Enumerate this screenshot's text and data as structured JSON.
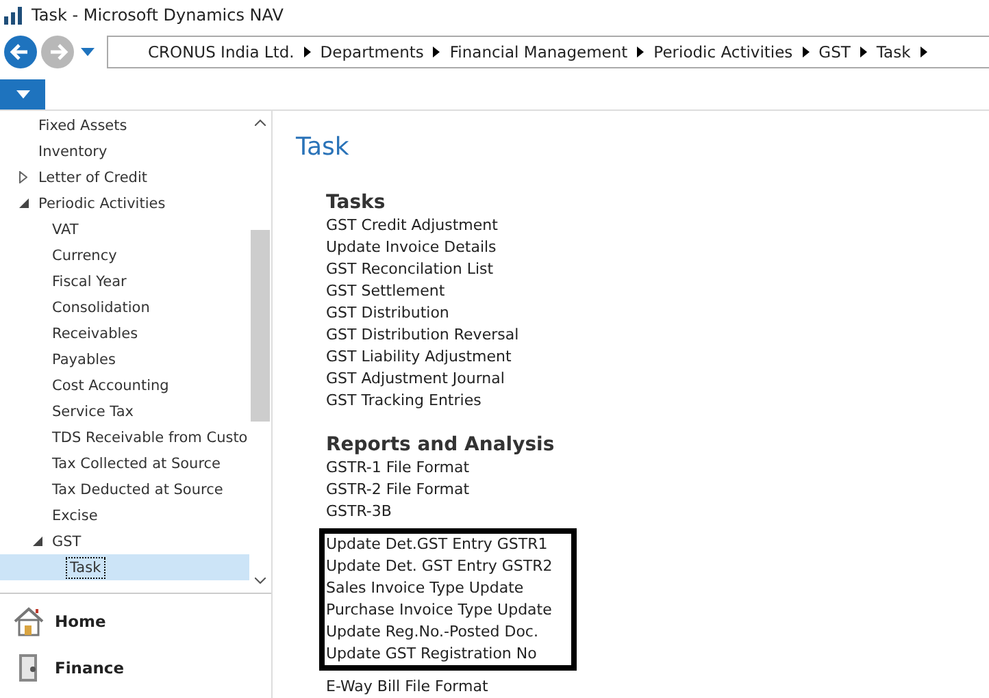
{
  "window": {
    "title": "Task - Microsoft Dynamics NAV"
  },
  "breadcrumb": [
    "CRONUS India Ltd.",
    "Departments",
    "Financial Management",
    "Periodic Activities",
    "GST",
    "Task"
  ],
  "sidebar": {
    "items": [
      {
        "label": "Fixed Assets",
        "selected": false
      },
      {
        "label": "Inventory",
        "selected": false
      },
      {
        "label": "Letter of Credit",
        "selected": false,
        "expanded": false
      },
      {
        "label": "Periodic Activities",
        "selected": false,
        "expanded": true,
        "children": [
          {
            "label": "VAT",
            "selected": false
          },
          {
            "label": "Currency",
            "selected": false
          },
          {
            "label": "Fiscal Year",
            "selected": false
          },
          {
            "label": "Consolidation",
            "selected": false
          },
          {
            "label": "Receivables",
            "selected": false
          },
          {
            "label": "Payables",
            "selected": false
          },
          {
            "label": "Cost Accounting",
            "selected": false
          },
          {
            "label": "Service Tax",
            "selected": false
          },
          {
            "label": "TDS Receivable from Custo",
            "selected": false
          },
          {
            "label": "Tax Collected at Source",
            "selected": false
          },
          {
            "label": "Tax Deducted at Source",
            "selected": false
          },
          {
            "label": "Excise",
            "selected": false
          },
          {
            "label": "GST",
            "selected": false,
            "expanded": true,
            "children": [
              {
                "label": "Task",
                "selected": true
              }
            ]
          }
        ]
      }
    ]
  },
  "nav_buttons": [
    {
      "label": "Home",
      "kind": "home"
    },
    {
      "label": "Finance",
      "kind": "finance"
    }
  ],
  "page_title": "Task",
  "sections": [
    {
      "heading": "Tasks",
      "blocks": [
        {
          "framed": false,
          "items": [
            "GST Credit Adjustment",
            "Update Invoice Details",
            "GST Reconcilation List",
            "GST Settlement",
            "GST Distribution",
            "GST Distribution Reversal",
            "GST Liability Adjustment",
            "GST Adjustment Journal",
            "GST Tracking Entries"
          ]
        }
      ]
    },
    {
      "heading": "Reports and Analysis",
      "blocks": [
        {
          "framed": false,
          "items": [
            "GSTR-1 File Format",
            "GSTR-2 File Format",
            "GSTR-3B"
          ]
        },
        {
          "framed": true,
          "items": [
            "Update Det.GST Entry GSTR1",
            "Update Det. GST Entry GSTR2",
            "Sales Invoice Type Update",
            "Purchase Invoice Type Update",
            "Update Reg.No.-Posted Doc.",
            "Update GST Registration No"
          ]
        },
        {
          "framed": false,
          "items": [
            "E-Way Bill File Format"
          ]
        }
      ]
    }
  ]
}
